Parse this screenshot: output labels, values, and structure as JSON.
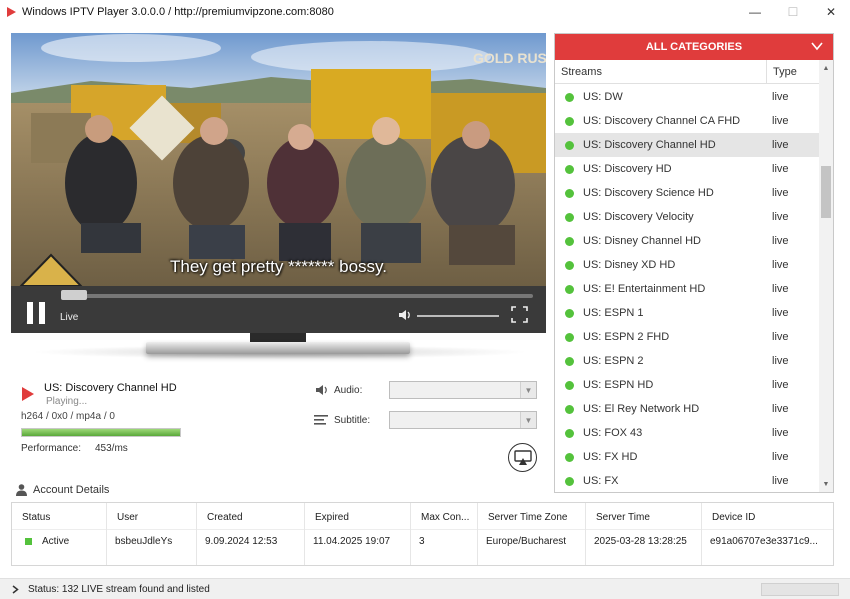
{
  "window": {
    "title": "Windows IPTV Player 3.0.0.0 / http://premiumvipzone.com:8080",
    "min_label": "—",
    "max_label": "☐",
    "close_label": "✕"
  },
  "player": {
    "subtitle_text": "They get pretty ******* bossy.",
    "live_label": "Live",
    "watermark": "GOLD RUSH",
    "seek_progress": 0.05,
    "volume": 1.0
  },
  "now_playing": {
    "channel": "US: Discovery Channel HD",
    "status": "Playing...",
    "codec": "h264 / 0x0 / mp4a / 0",
    "performance_label": "Performance:",
    "performance_value": "453/ms",
    "performance_fill": 1.0,
    "audio_label": "Audio:",
    "subtitle_label": "Subtitle:",
    "audio_value": "",
    "subtitle_value": ""
  },
  "categories": {
    "header": "ALL CATEGORIES",
    "col_streams": "Streams",
    "col_type": "Type",
    "streams": [
      {
        "name": "US: DW",
        "type": "live"
      },
      {
        "name": "US: Discovery Channel CA FHD",
        "type": "live"
      },
      {
        "name": "US: Discovery Channel HD",
        "type": "live",
        "selected": true
      },
      {
        "name": "US: Discovery HD",
        "type": "live"
      },
      {
        "name": "US: Discovery Science HD",
        "type": "live"
      },
      {
        "name": "US: Discovery Velocity",
        "type": "live"
      },
      {
        "name": "US: Disney Channel HD",
        "type": "live"
      },
      {
        "name": "US: Disney XD HD",
        "type": "live"
      },
      {
        "name": "US: E! Entertainment HD",
        "type": "live"
      },
      {
        "name": "US: ESPN 1",
        "type": "live"
      },
      {
        "name": "US: ESPN 2 FHD",
        "type": "live"
      },
      {
        "name": "US: ESPN 2",
        "type": "live"
      },
      {
        "name": "US: ESPN HD",
        "type": "live"
      },
      {
        "name": "US: El Rey Network HD",
        "type": "live"
      },
      {
        "name": "US: FOX 43",
        "type": "live"
      },
      {
        "name": "US: FX HD",
        "type": "live"
      },
      {
        "name": "US: FX",
        "type": "live"
      }
    ]
  },
  "account": {
    "title": "Account Details",
    "headers": {
      "status": "Status",
      "user": "User",
      "created": "Created",
      "expired": "Expired",
      "max_con": "Max Con...",
      "server_tz": "Server Time Zone",
      "server_time": "Server Time",
      "device_id": "Device ID"
    },
    "values": {
      "status": "Active",
      "user": "bsbeuJdleYs",
      "created": "9.09.2024 12:53",
      "expired": "11.04.2025 19:07",
      "max_con": "3",
      "server_tz": "Europe/Bucharest",
      "server_time": "2025-03-28 13:28:25",
      "device_id": "e91a06707e3e3371c9..."
    }
  },
  "statusbar": {
    "text": "Status: 132 LIVE stream found and listed"
  },
  "colors": {
    "accent": "#e03c3c",
    "live_dot": "#54c23c",
    "play_icon": "#e03c3c"
  }
}
